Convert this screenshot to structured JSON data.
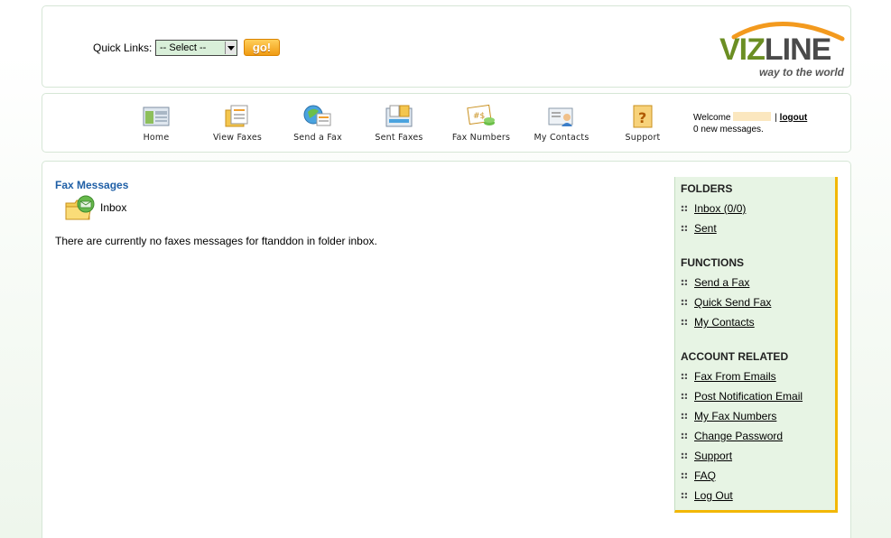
{
  "header": {
    "quick_links_label": "Quick Links:",
    "select_value": "-- Select --",
    "go_label": "go!",
    "logo_part1": "VIZ",
    "logo_part2": "LINE",
    "logo_tagline": "way to the world"
  },
  "nav": {
    "items": [
      {
        "label": "Home",
        "icon": "home-icon"
      },
      {
        "label": "View Faxes",
        "icon": "view-faxes-icon"
      },
      {
        "label": "Send a Fax",
        "icon": "send-fax-icon"
      },
      {
        "label": "Sent Faxes",
        "icon": "sent-faxes-icon"
      },
      {
        "label": "Fax Numbers",
        "icon": "fax-numbers-icon"
      },
      {
        "label": "My Contacts",
        "icon": "contacts-icon"
      },
      {
        "label": "Support",
        "icon": "support-icon"
      }
    ],
    "welcome_prefix": "Welcome",
    "separator": "|",
    "logout_label": "logout",
    "messages_text": "0 new messages."
  },
  "main": {
    "title": "Fax Messages",
    "folder_label": "Inbox",
    "empty_message": "There are currently no faxes messages for ftanddon in folder inbox."
  },
  "sidebar": {
    "folders_heading": "FOLDERS",
    "folders": [
      "Inbox (0/0)",
      "Sent"
    ],
    "functions_heading": "FUNCTIONS",
    "functions": [
      "Send a Fax",
      "Quick Send Fax",
      "My Contacts"
    ],
    "account_heading": "ACCOUNT RELATED",
    "account": [
      "Fax From Emails",
      "Post Notification Email",
      "My Fax Numbers",
      "Change Password",
      "Support",
      "FAQ",
      "Log Out"
    ]
  },
  "colors": {
    "accent_blue": "#1f5fa6",
    "sidebar_bg": "#e7f4e4",
    "sidebar_border": "#f2b705",
    "go_button": "#f09b13"
  }
}
